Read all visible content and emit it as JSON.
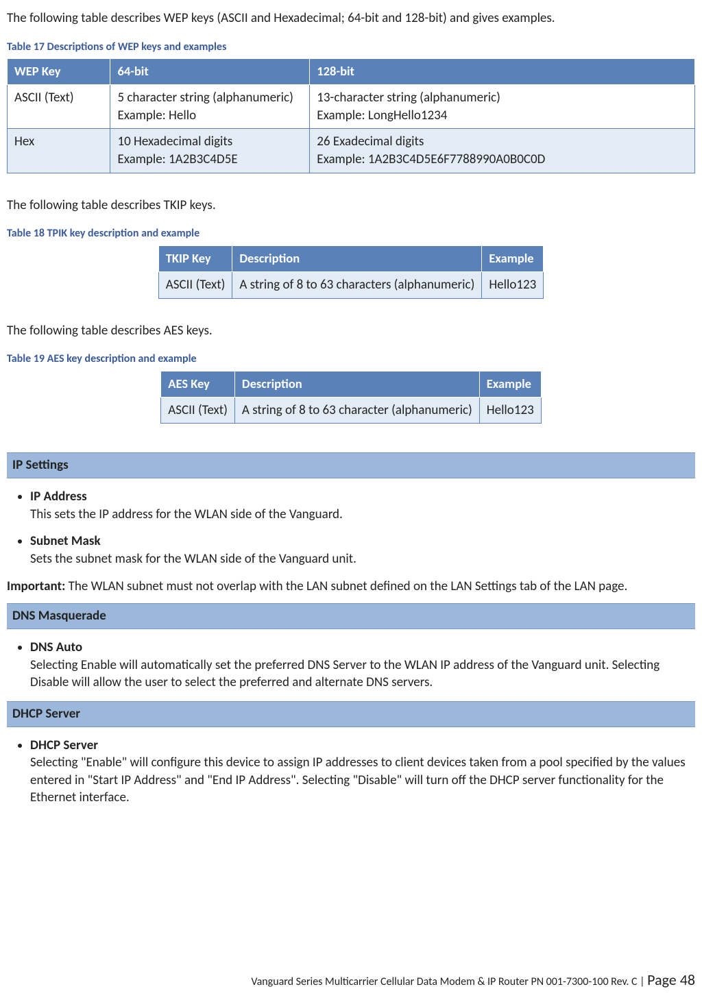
{
  "intro": {
    "p_wep": "The following table describes WEP keys (ASCII and Hexadecimal; 64-bit and 128-bit) and gives examples.",
    "p_tkip": "The following table describes TKIP keys.",
    "p_aes": "The following table describes AES keys."
  },
  "captions": {
    "t17": "Table 17 Descriptions of WEP keys and examples",
    "t18": "Table 18 TPIK key description and example",
    "t19": "Table 19 AES key description and example"
  },
  "wep": {
    "head": {
      "c0": "WEP Key",
      "c1": "64-bit",
      "c2": "128-bit"
    },
    "rows": [
      {
        "c0": "ASCII (Text)",
        "c1a": "5 character string (alphanumeric)",
        "c1b": "Example: Hello",
        "c2a": "13-character string (alphanumeric)",
        "c2b": "Example: LongHello1234",
        "shade": "plain"
      },
      {
        "c0": "Hex",
        "c1a": "10 Hexadecimal digits",
        "c1b": "Example: 1A2B3C4D5E",
        "c2a": "26 Exadecimal digits",
        "c2b": "Example: 1A2B3C4D5E6F7788990A0B0C0D",
        "shade": "shade"
      }
    ]
  },
  "tkip": {
    "head": {
      "c0": "TKIP Key",
      "c1": "Description",
      "c2": "Example"
    },
    "row": {
      "c0": "ASCII (Text)",
      "c1": "A string of 8 to 63 characters (alphanumeric)",
      "c2": "Hello123"
    }
  },
  "aes": {
    "head": {
      "c0": "AES Key",
      "c1": "Description",
      "c2": "Example"
    },
    "row": {
      "c0": "ASCII (Text)",
      "c1": "A string of 8 to 63 character (alphanumeric)",
      "c2": "Hello123"
    }
  },
  "sections": {
    "ip": {
      "title": "IP Settings",
      "items": [
        {
          "title": "IP Address",
          "body": "This sets the IP address for the WLAN side of the Vanguard."
        },
        {
          "title": "Subnet Mask",
          "body": "Sets the subnet mask for the WLAN side of the Vanguard unit."
        }
      ],
      "important_label": "Important:",
      "important_text": " The WLAN subnet must not overlap with the LAN subnet defined on the LAN Settings tab of the LAN page."
    },
    "dns": {
      "title": "DNS Masquerade",
      "items": [
        {
          "title": "DNS Auto",
          "body": "Selecting Enable will automatically set the preferred DNS Server to the WLAN IP address of the Vanguard unit. Selecting Disable will allow the user to select the preferred and alternate DNS servers."
        }
      ]
    },
    "dhcp": {
      "title": "DHCP Server",
      "items": [
        {
          "title": "DHCP Server",
          "body": "Selecting \"Enable\" will configure this device to assign IP addresses to client devices taken from a pool specified by the values entered in \"Start IP Address\" and \"End IP Address\". Selecting \"Disable\" will turn off the DHCP server functionality for the Ethernet interface."
        }
      ]
    }
  },
  "footer": {
    "left": "Vanguard Series Multicarrier Cellular Data Modem & IP Router PN 001-7300-100 Rev. C",
    "sep": " | ",
    "page_label": "Page 48"
  }
}
